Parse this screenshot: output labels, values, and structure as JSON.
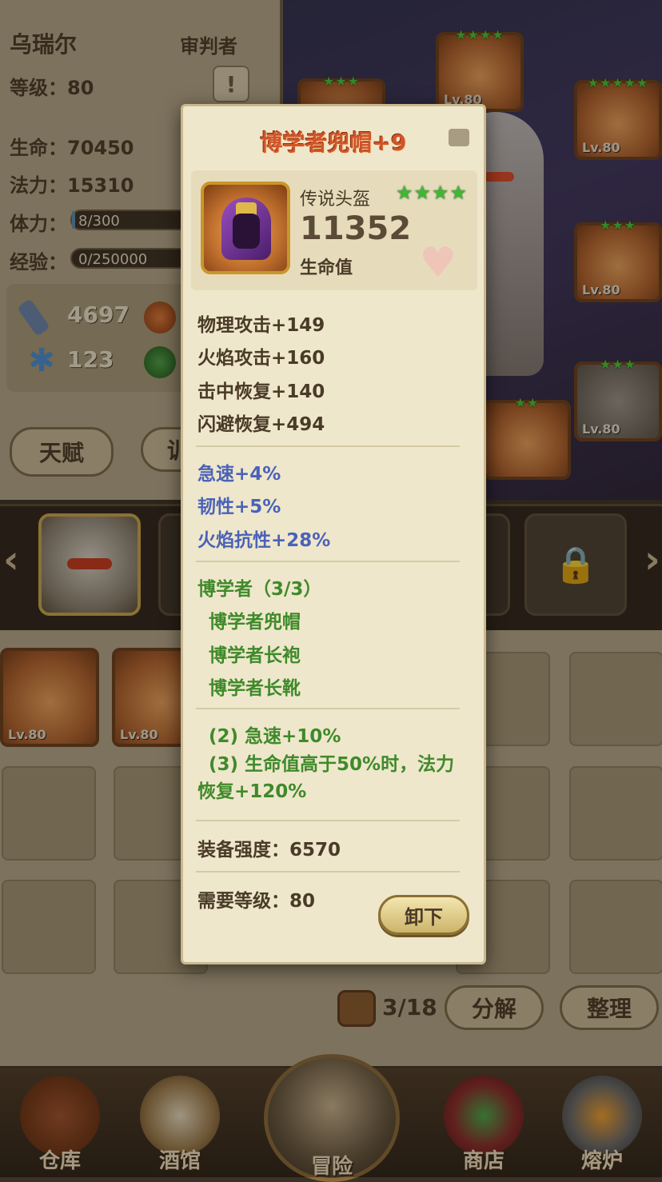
{
  "hero": {
    "name": "乌瑞尔",
    "class": "审判者",
    "level_label": "等级：80",
    "hp_label": "生命：70450",
    "mana_label": "法力：15310",
    "stamina_label": "体力：",
    "stamina_value": "8/300",
    "stamina_fraction": 0.027,
    "exp_label": "经验：",
    "exp_value": "0/250000",
    "exp_fraction": 0,
    "attack": "4697",
    "crit": "123",
    "alert_symbol": "!"
  },
  "buttons": {
    "talent": "天赋",
    "train_partial": "训",
    "decompose": "分解",
    "sort": "整理",
    "unequip": "卸下"
  },
  "equipped_slots": [
    {
      "level": "Lv.80",
      "stars": "★★★★"
    },
    {
      "level": "Lv.80",
      "stars": "★★★"
    },
    {
      "level": "Lv.80",
      "stars": "★★★★★"
    },
    {
      "level": "Lv.80",
      "stars": "★★★"
    },
    {
      "level": "Lv.80",
      "stars": "★★★"
    },
    {
      "level": "Lv.80",
      "stars": "★★"
    }
  ],
  "inventory": {
    "items": [
      {
        "level": "Lv.80"
      },
      {
        "level": "Lv.80"
      }
    ],
    "count": "3/18"
  },
  "tooltip": {
    "title": "博学者兜帽+9",
    "type": "传说头盔",
    "stars": "★★★★",
    "value": "11352",
    "value_label": "生命值",
    "base_stats": [
      "物理攻击+149",
      "火焰攻击+160",
      "击中恢复+140",
      "闪避恢复+494"
    ],
    "bonus_stats": [
      "急速+4%",
      "韧性+5%",
      "火焰抗性+28%"
    ],
    "set_name": "博学者（3/3）",
    "set_items": [
      "博学者兜帽",
      "博学者长袍",
      "博学者长靴"
    ],
    "set_bonus_1": "(2) 急速+10%",
    "set_bonus_2": "(3) 生命值高于50%时，法力恢复+120%",
    "strength": "装备强度：6570",
    "required_level": "需要等级：80"
  },
  "nav": {
    "warehouse": "仓库",
    "tavern": "酒馆",
    "adventure": "冒险",
    "shop": "商店",
    "forge": "熔炉"
  },
  "colors": {
    "title_orange": "#d0552a",
    "stat_blue": "#4a62b8",
    "set_green": "#3f8a2a",
    "star_green": "#3fb833"
  }
}
